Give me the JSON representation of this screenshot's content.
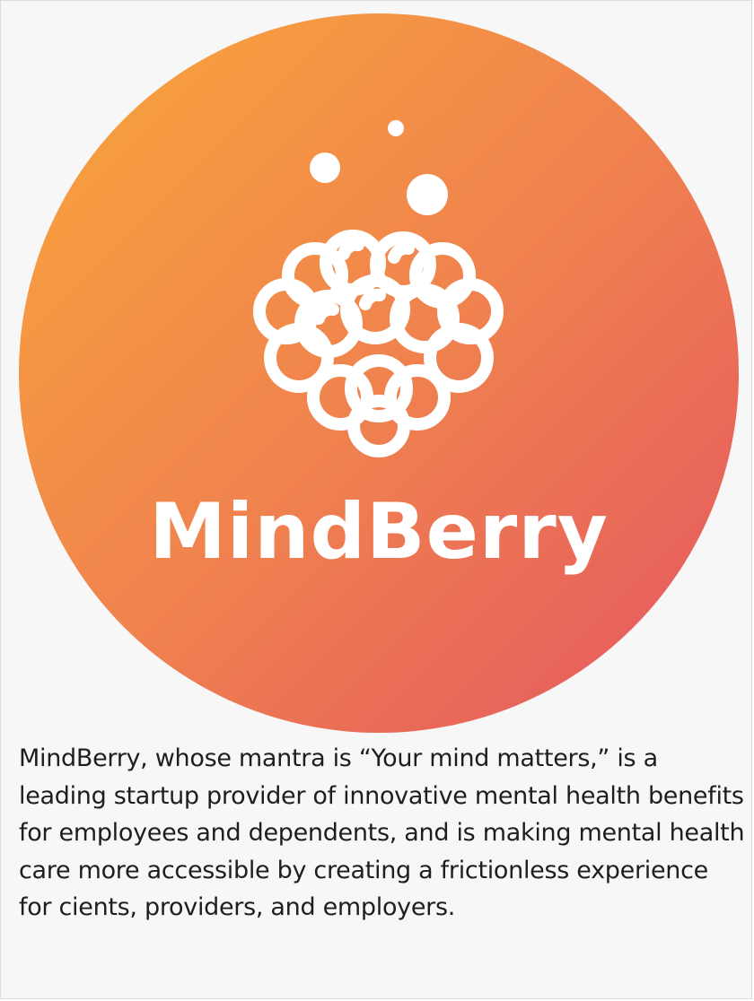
{
  "brand": {
    "name": "MindBerry",
    "gradient_start": "#F9A73A",
    "gradient_mid": "#F0834E",
    "gradient_end": "#E45561",
    "mark_color": "#FFFFFF"
  },
  "logo": {
    "icon": "raspberry-icon"
  },
  "description": {
    "text": "MindBerry, whose mantra is “Your mind matters,” is a leading startup provider of innovative mental health benefits for employees and dependents, and is making mental health care more accessible by creating a frictionless experience for cients, providers, and employers."
  }
}
